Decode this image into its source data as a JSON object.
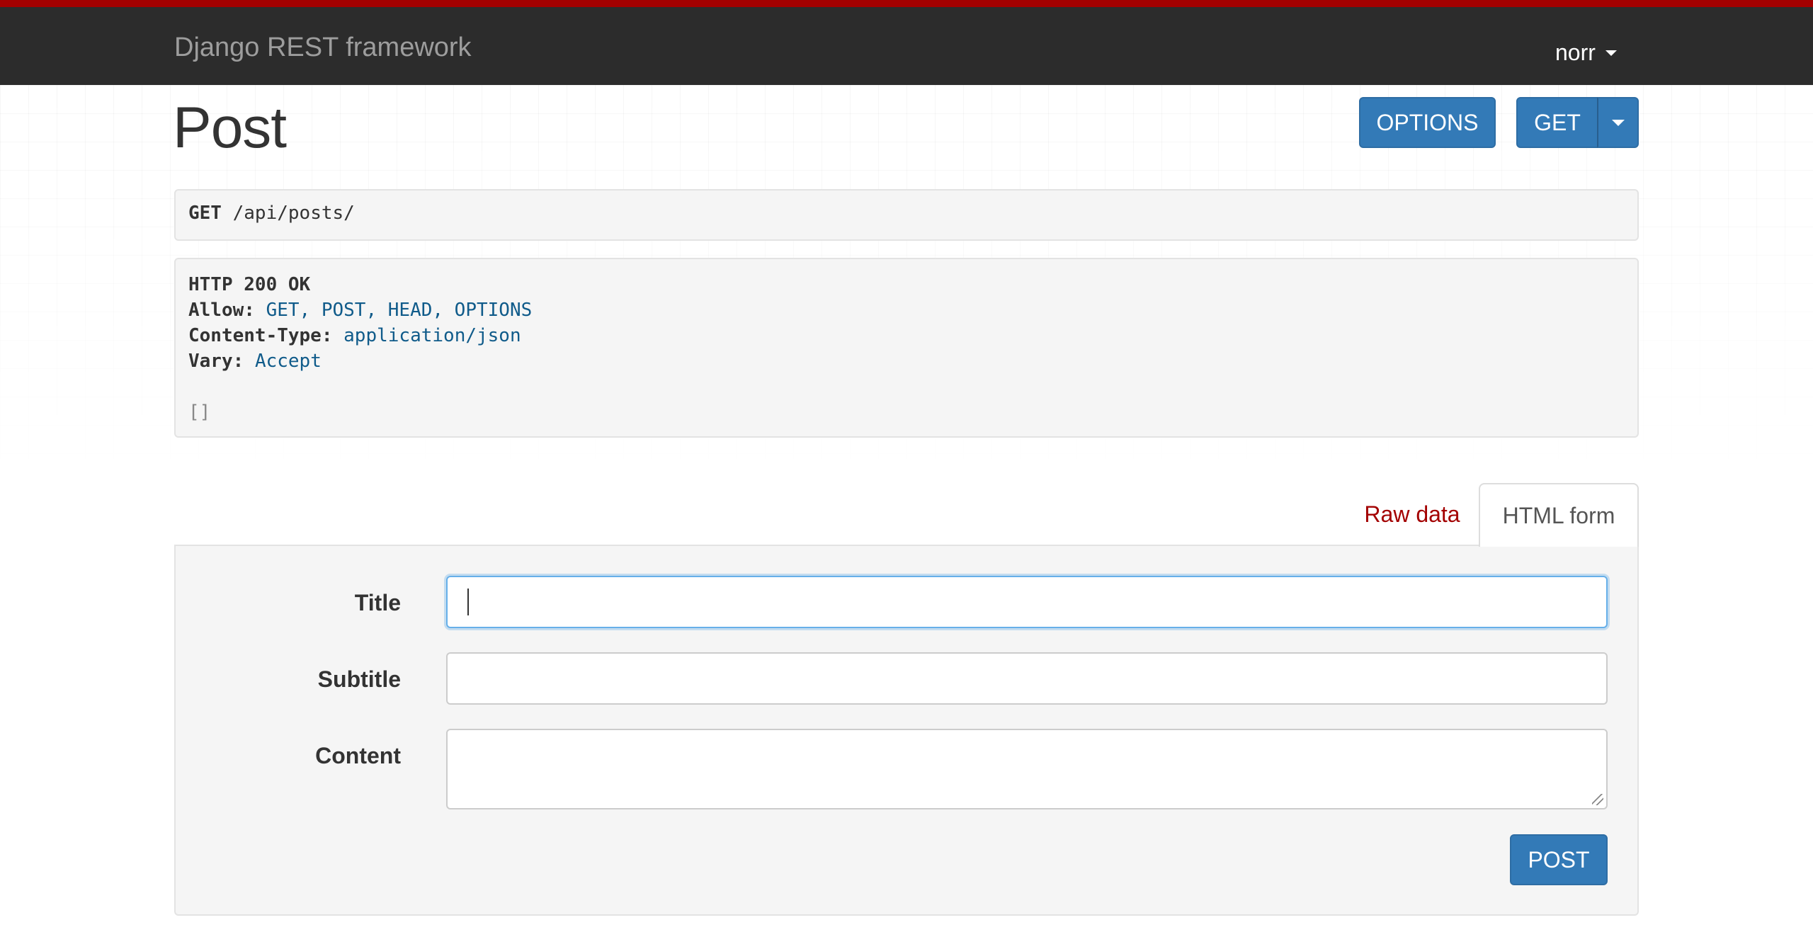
{
  "navbar": {
    "brand": "Django REST framework",
    "user": "norr",
    "accent_color": "#a30000"
  },
  "page": {
    "title": "Post"
  },
  "actions": {
    "options_label": "OPTIONS",
    "get_label": "GET"
  },
  "request": {
    "method": "GET",
    "path": "/api/posts/"
  },
  "response": {
    "status": "HTTP 200 OK",
    "headers": [
      {
        "key": "Allow:",
        "value": "GET, POST, HEAD, OPTIONS"
      },
      {
        "key": "Content-Type:",
        "value": "application/json"
      },
      {
        "key": "Vary:",
        "value": "Accept"
      }
    ],
    "body": "[]"
  },
  "tabs": {
    "raw": "Raw data",
    "html": "HTML form",
    "active": "HTML form"
  },
  "form": {
    "fields": [
      {
        "label": "Title",
        "value": ""
      },
      {
        "label": "Subtitle",
        "value": ""
      },
      {
        "label": "Content",
        "value": ""
      }
    ],
    "submit_label": "POST"
  },
  "icons": [
    "caret-down-icon",
    "caret-down-icon",
    "textarea-resize-icon"
  ]
}
